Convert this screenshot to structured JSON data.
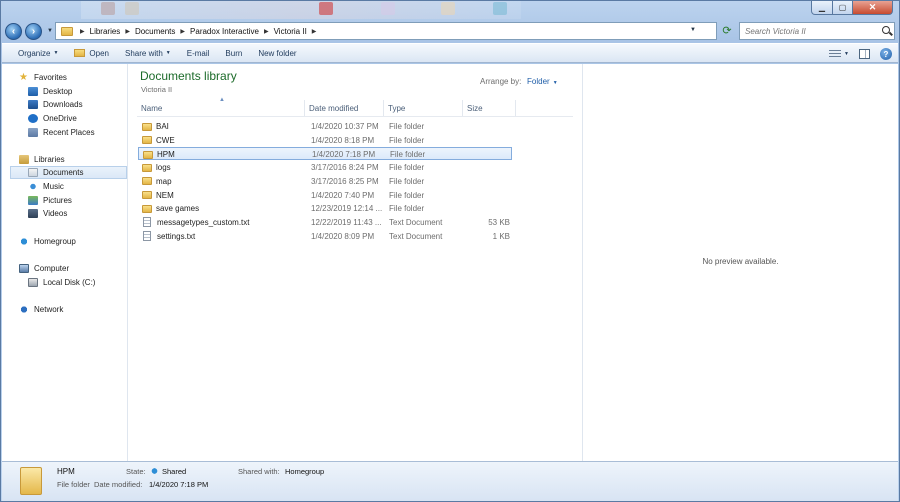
{
  "address": {
    "crumbs": [
      "Libraries",
      "Documents",
      "Paradox Interactive",
      "Victoria II"
    ]
  },
  "search": {
    "placeholder": "Search Victoria II"
  },
  "toolbar": {
    "organize": "Organize",
    "open": "Open",
    "share_with": "Share with",
    "email": "E-mail",
    "burn": "Burn",
    "new_folder": "New folder"
  },
  "nav": {
    "favorites": "Favorites",
    "desktop": "Desktop",
    "downloads": "Downloads",
    "onedrive": "OneDrive",
    "recent": "Recent Places",
    "libraries": "Libraries",
    "documents": "Documents",
    "music": "Music",
    "pictures": "Pictures",
    "videos": "Videos",
    "homegroup": "Homegroup",
    "computer": "Computer",
    "local_disk": "Local Disk (C:)",
    "network": "Network"
  },
  "library": {
    "title": "Documents library",
    "subtitle": "Victoria II",
    "arrange_label": "Arrange by:",
    "arrange_value": "Folder"
  },
  "columns": {
    "name": "Name",
    "date": "Date modified",
    "type": "Type",
    "size": "Size"
  },
  "files": [
    {
      "name": "BAI",
      "date": "1/4/2020 10:37 PM",
      "type": "File folder",
      "size": "",
      "kind": "folder"
    },
    {
      "name": "CWE",
      "date": "1/4/2020 8:18 PM",
      "type": "File folder",
      "size": "",
      "kind": "folder"
    },
    {
      "name": "HPM",
      "date": "1/4/2020 7:18 PM",
      "type": "File folder",
      "size": "",
      "kind": "folder"
    },
    {
      "name": "logs",
      "date": "3/17/2016 8:24 PM",
      "type": "File folder",
      "size": "",
      "kind": "folder"
    },
    {
      "name": "map",
      "date": "3/17/2016 8:25 PM",
      "type": "File folder",
      "size": "",
      "kind": "folder"
    },
    {
      "name": "NEM",
      "date": "1/4/2020 7:40 PM",
      "type": "File folder",
      "size": "",
      "kind": "folder"
    },
    {
      "name": "save games",
      "date": "12/23/2019 12:14 ...",
      "type": "File folder",
      "size": "",
      "kind": "folder"
    },
    {
      "name": "messagetypes_custom.txt",
      "date": "12/22/2019 11:43 ...",
      "type": "Text Document",
      "size": "53 KB",
      "kind": "file"
    },
    {
      "name": "settings.txt",
      "date": "1/4/2020 8:09 PM",
      "type": "Text Document",
      "size": "1 KB",
      "kind": "file"
    }
  ],
  "selected_index": 2,
  "preview": {
    "message": "No preview available."
  },
  "details": {
    "name": "HPM",
    "type": "File folder",
    "state_label": "State:",
    "state_value": "Shared",
    "shared_label": "Shared with:",
    "shared_value": "Homegroup",
    "date_label": "Date modified:",
    "date_value": "1/4/2020 7:18 PM"
  },
  "colors": {
    "accent": "#1f5ea8",
    "library_title": "#1c6b2a",
    "selection_border": "#84acdd"
  }
}
